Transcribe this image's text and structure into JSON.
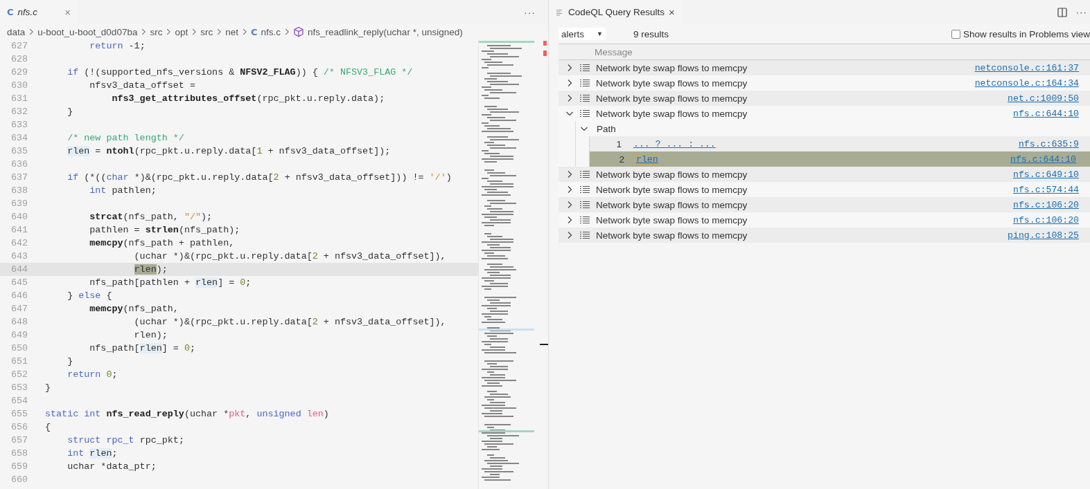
{
  "editor": {
    "tab": {
      "icon": "C",
      "title": "nfs.c",
      "close": "×",
      "selected": true
    },
    "more": "···",
    "breadcrumbs": [
      {
        "text": "data"
      },
      {
        "text": "u-boot_u-boot_d0d07ba"
      },
      {
        "text": "src"
      },
      {
        "text": "opt"
      },
      {
        "text": "src"
      },
      {
        "text": "net"
      },
      {
        "text": "nfs.c",
        "icon": "C"
      },
      {
        "text": "nfs_readlink_reply(uchar *, unsigned)",
        "kind": "symbol"
      }
    ],
    "lines": [
      {
        "number": "627",
        "current": false,
        "tokens": [
          {
            "kind": "keyword",
            "text": "        return"
          },
          {
            "kind": "plain",
            "text": " -1;"
          }
        ]
      },
      {
        "number": "628",
        "current": false
      },
      {
        "number": "629",
        "current": false,
        "tokens": [
          {
            "kind": "keyword",
            "text": "    if"
          },
          {
            "kind": "plain",
            "text": " (!(supported_nfs_versions & "
          },
          {
            "kind": "function",
            "text": "NFSV2_FLAG"
          },
          {
            "kind": "plain",
            "text": ")) { "
          },
          {
            "kind": "comment",
            "text": "/* NFSV3_FLAG */"
          }
        ]
      },
      {
        "number": "630",
        "current": false,
        "tokens": [
          {
            "kind": "plain",
            "text": "        nfsv3_data_offset ="
          }
        ]
      },
      {
        "number": "631",
        "current": false,
        "tokens": [
          {
            "kind": "function",
            "text": "            nfs3_get_attributes_offset"
          },
          {
            "kind": "plain",
            "text": "(rpc_pkt.u.reply.data);"
          }
        ]
      },
      {
        "number": "632",
        "current": false,
        "tokens": [
          {
            "kind": "plain",
            "text": "    }"
          }
        ]
      },
      {
        "number": "633",
        "current": false
      },
      {
        "number": "634",
        "current": false,
        "tokens": [
          {
            "kind": "comment",
            "text": "    /* new path length */"
          }
        ]
      },
      {
        "number": "635",
        "current": false,
        "tokens": [
          {
            "kind": "reference",
            "text": "    rlen"
          },
          {
            "kind": "plain",
            "text": " = "
          },
          {
            "kind": "function",
            "text": "ntohl"
          },
          {
            "kind": "plain",
            "text": "(rpc_pkt.u.reply.data["
          },
          {
            "kind": "number",
            "text": "1"
          },
          {
            "kind": "plain",
            "text": " + nfsv3_data_offset]);"
          }
        ]
      },
      {
        "number": "636",
        "current": false
      },
      {
        "number": "637",
        "current": false,
        "tokens": [
          {
            "kind": "keyword",
            "text": "    if"
          },
          {
            "kind": "plain",
            "text": " (*(("
          },
          {
            "kind": "keyword",
            "text": "char"
          },
          {
            "kind": "plain",
            "text": " *)&(rpc_pkt.u.reply.data["
          },
          {
            "kind": "number",
            "text": "2"
          },
          {
            "kind": "plain",
            "text": " + nfsv3_data_offset])) != "
          },
          {
            "kind": "string",
            "text": "'/'"
          },
          {
            "kind": "plain",
            "text": ")"
          }
        ]
      },
      {
        "number": "638",
        "current": false,
        "tokens": [
          {
            "kind": "keyword",
            "text": "        int"
          },
          {
            "kind": "plain",
            "text": " pathlen;"
          }
        ]
      },
      {
        "number": "639",
        "current": false
      },
      {
        "number": "640",
        "current": false,
        "tokens": [
          {
            "kind": "function",
            "text": "        strcat"
          },
          {
            "kind": "plain",
            "text": "(nfs_path, "
          },
          {
            "kind": "string",
            "text": "\"/\""
          },
          {
            "kind": "plain",
            "text": ");"
          }
        ]
      },
      {
        "number": "641",
        "current": false,
        "tokens": [
          {
            "kind": "plain",
            "text": "        pathlen = "
          },
          {
            "kind": "function",
            "text": "strlen"
          },
          {
            "kind": "plain",
            "text": "(nfs_path);"
          }
        ]
      },
      {
        "number": "642",
        "current": false,
        "tokens": [
          {
            "kind": "function",
            "text": "        memcpy"
          },
          {
            "kind": "plain",
            "text": "(nfs_path + pathlen,"
          }
        ]
      },
      {
        "number": "643",
        "current": false,
        "tokens": [
          {
            "kind": "plain",
            "text": "                (uchar *)&(rpc_pkt.u.reply.data["
          },
          {
            "kind": "number",
            "text": "2"
          },
          {
            "kind": "plain",
            "text": " + nfsv3_data_offset]),"
          }
        ]
      },
      {
        "number": "644",
        "current": true,
        "tokens": [
          {
            "kind": "match",
            "text": "                rlen"
          },
          {
            "kind": "plain",
            "text": ");"
          }
        ]
      },
      {
        "number": "645",
        "current": false,
        "tokens": [
          {
            "kind": "plain",
            "text": "        nfs_path[pathlen + "
          },
          {
            "kind": "reference",
            "text": "rlen"
          },
          {
            "kind": "plain",
            "text": "] = "
          },
          {
            "kind": "number",
            "text": "0"
          },
          {
            "kind": "plain",
            "text": ";"
          }
        ]
      },
      {
        "number": "646",
        "current": false,
        "tokens": [
          {
            "kind": "plain",
            "text": "    } "
          },
          {
            "kind": "keyword",
            "text": "else"
          },
          {
            "kind": "plain",
            "text": " {"
          }
        ]
      },
      {
        "number": "647",
        "current": false,
        "tokens": [
          {
            "kind": "function",
            "text": "        memcpy"
          },
          {
            "kind": "plain",
            "text": "(nfs_path,"
          }
        ]
      },
      {
        "number": "648",
        "current": false,
        "tokens": [
          {
            "kind": "plain",
            "text": "                (uchar *)&(rpc_pkt.u.reply.data["
          },
          {
            "kind": "number",
            "text": "2"
          },
          {
            "kind": "plain",
            "text": " + nfsv3_data_offset]),"
          }
        ]
      },
      {
        "number": "649",
        "current": false,
        "tokens": [
          {
            "kind": "plain",
            "text": "                rlen);"
          }
        ]
      },
      {
        "number": "650",
        "current": false,
        "tokens": [
          {
            "kind": "plain",
            "text": "        nfs_path["
          },
          {
            "kind": "reference",
            "text": "rlen"
          },
          {
            "kind": "plain",
            "text": "] = "
          },
          {
            "kind": "number",
            "text": "0"
          },
          {
            "kind": "plain",
            "text": ";"
          }
        ]
      },
      {
        "number": "651",
        "current": false,
        "tokens": [
          {
            "kind": "plain",
            "text": "    }"
          }
        ]
      },
      {
        "number": "652",
        "current": false,
        "tokens": [
          {
            "kind": "keyword",
            "text": "    return"
          },
          {
            "kind": "number",
            "text": " 0"
          },
          {
            "kind": "plain",
            "text": ";"
          }
        ]
      },
      {
        "number": "653",
        "current": false,
        "tokens": [
          {
            "kind": "plain",
            "text": "}"
          }
        ]
      },
      {
        "number": "654",
        "current": false
      },
      {
        "number": "655",
        "current": false,
        "tokens": [
          {
            "kind": "keyword",
            "text": "static int"
          },
          {
            "kind": "function",
            "text": " nfs_read_reply"
          },
          {
            "kind": "plain",
            "text": "(uchar *"
          },
          {
            "kind": "parameter",
            "text": "pkt"
          },
          {
            "kind": "plain",
            "text": ", "
          },
          {
            "kind": "keyword",
            "text": "unsigned"
          },
          {
            "kind": "parameter",
            "text": " len"
          },
          {
            "kind": "plain",
            "text": ")"
          }
        ]
      },
      {
        "number": "656",
        "current": false,
        "tokens": [
          {
            "kind": "plain",
            "text": "{"
          }
        ]
      },
      {
        "number": "657",
        "current": false,
        "tokens": [
          {
            "kind": "keyword",
            "text": "    struct"
          },
          {
            "kind": "type",
            "text": " rpc_t"
          },
          {
            "kind": "plain",
            "text": " rpc_pkt;"
          }
        ]
      },
      {
        "number": "658",
        "current": false,
        "tokens": [
          {
            "kind": "keyword",
            "text": "    int"
          },
          {
            "kind": "reference",
            "text": " rlen"
          },
          {
            "kind": "plain",
            "text": ";"
          }
        ]
      },
      {
        "number": "659",
        "current": false,
        "tokens": [
          {
            "kind": "plain",
            "text": "    uchar *data_ptr;"
          }
        ]
      },
      {
        "number": "660",
        "current": false
      }
    ]
  },
  "results": {
    "tab": {
      "title": "CodeQL Query Results",
      "close": "×",
      "selected": true
    },
    "more": "···",
    "select": {
      "value": "alerts",
      "caret": "▼"
    },
    "count": "9 results",
    "problems_checkbox": {
      "label": "Show results in Problems view",
      "checked": false
    },
    "columns": [
      "Message"
    ],
    "rows": [
      {
        "message": "Network byte swap flows to memcpy",
        "location": "netconsole.c:161:37",
        "expanded": false
      },
      {
        "message": "Network byte swap flows to memcpy",
        "location": "netconsole.c:164:34",
        "expanded": false
      },
      {
        "message": "Network byte swap flows to memcpy",
        "location": "net.c:1009:50",
        "expanded": false
      },
      {
        "message": "Network byte swap flows to memcpy",
        "location": "nfs.c:644:10",
        "expanded": true,
        "path": {
          "label": "Path",
          "expanded": true,
          "steps": [
            {
              "number": "1",
              "text": "... ? ... : ...",
              "location": "nfs.c:635:9",
              "selected": false
            },
            {
              "number": "2",
              "text": "rlen",
              "location": "nfs.c:644:10",
              "selected": true
            }
          ]
        }
      },
      {
        "message": "Network byte swap flows to memcpy",
        "location": "nfs.c:649:10",
        "expanded": false
      },
      {
        "message": "Network byte swap flows to memcpy",
        "location": "nfs.c:574:44",
        "expanded": false
      },
      {
        "message": "Network byte swap flows to memcpy",
        "location": "nfs.c:106:20",
        "expanded": false
      },
      {
        "message": "Network byte swap flows to memcpy",
        "location": "nfs.c:106:20",
        "expanded": false
      },
      {
        "message": "Network byte swap flows to memcpy",
        "location": "ping.c:108:25",
        "expanded": false
      }
    ]
  }
}
